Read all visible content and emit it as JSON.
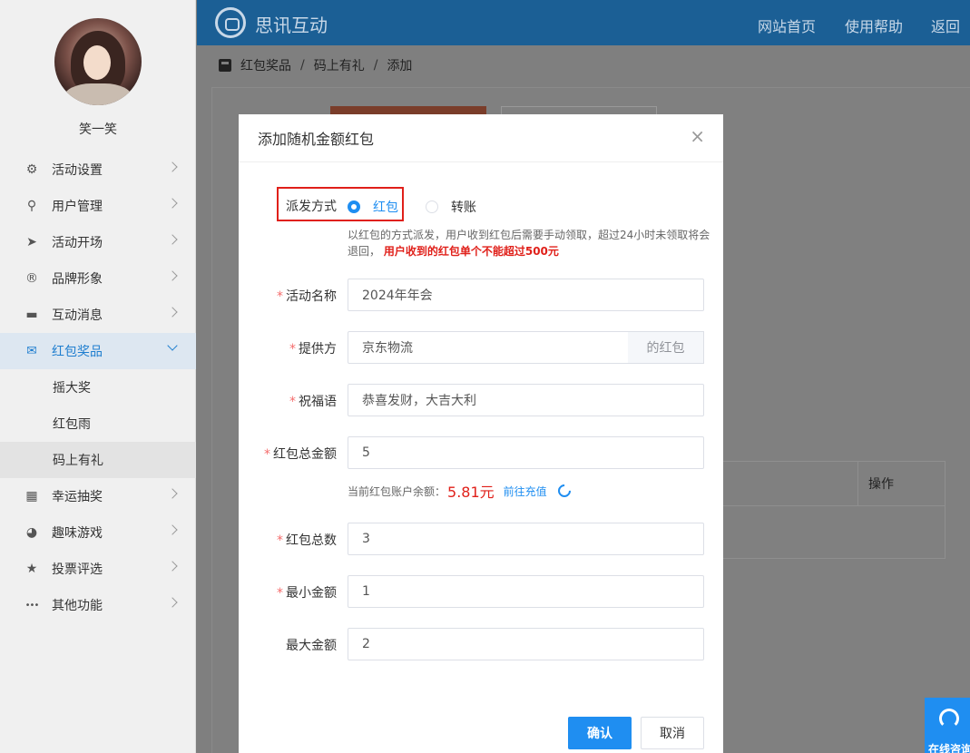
{
  "user": {
    "name": "笑一笑"
  },
  "sidebar": {
    "items": [
      {
        "label": "活动设置",
        "icon": "gears-icon",
        "glyph": "⚙"
      },
      {
        "label": "用户管理",
        "icon": "user-icon",
        "glyph": "👤"
      },
      {
        "label": "活动开场",
        "icon": "paper-plane-icon",
        "glyph": "➤"
      },
      {
        "label": "品牌形象",
        "icon": "registered-icon",
        "glyph": "®"
      },
      {
        "label": "互动消息",
        "icon": "message-icon",
        "glyph": "▬"
      },
      {
        "label": "红包奖品",
        "icon": "red-envelope-icon",
        "glyph": "✉"
      }
    ],
    "sub_items": [
      {
        "label": "摇大奖"
      },
      {
        "label": "红包雨"
      },
      {
        "label": "码上有礼"
      }
    ],
    "items_after": [
      {
        "label": "幸运抽奖",
        "icon": "lottery-icon",
        "glyph": "▦"
      },
      {
        "label": "趣味游戏",
        "icon": "pacman-icon",
        "glyph": "◕"
      },
      {
        "label": "投票评选",
        "icon": "star-icon",
        "glyph": "★"
      },
      {
        "label": "其他功能",
        "icon": "more-icon",
        "glyph": "•••"
      }
    ]
  },
  "topbar": {
    "brand": "思讯互动",
    "nav": [
      "网站首页",
      "使用帮助",
      "返回"
    ]
  },
  "breadcrumb": [
    "红包奖品",
    "码上有礼",
    "添加"
  ],
  "background_table": {
    "header_op": "操作"
  },
  "modal": {
    "title": "添加随机金额红包",
    "close": "×",
    "dispatch": {
      "label": "派发方式",
      "options": [
        "红包",
        "转账"
      ],
      "selected": "红包"
    },
    "hint": "以红包的方式派发，用户收到红包后需要手动领取，超过24小时未领取将会退回，",
    "hint_warning": "用户收到的红包单个不能超过500元",
    "fields": {
      "activity_name": {
        "label": "活动名称",
        "value": "2024年年会"
      },
      "provider": {
        "label": "提供方",
        "value": "京东物流",
        "suffix": "的红包"
      },
      "greeting": {
        "label": "祝福语",
        "value": "恭喜发财，大吉大利"
      },
      "total_amount": {
        "label": "红包总金额",
        "value": "5"
      },
      "total_count": {
        "label": "红包总数",
        "value": "3"
      },
      "min_amount": {
        "label": "最小金额",
        "value": "1"
      },
      "max_amount": {
        "label": "最大金额",
        "value": "2"
      }
    },
    "balance": {
      "label": "当前红包账户余额：",
      "amount": "5.81元",
      "recharge": "前往充值"
    },
    "confirm": "确认",
    "cancel": "取消"
  },
  "chat_widget": {
    "label": "在线咨询"
  },
  "colors": {
    "primary": "#1f8ef1",
    "topbar": "#1b5f95",
    "danger": "#e0201a"
  }
}
